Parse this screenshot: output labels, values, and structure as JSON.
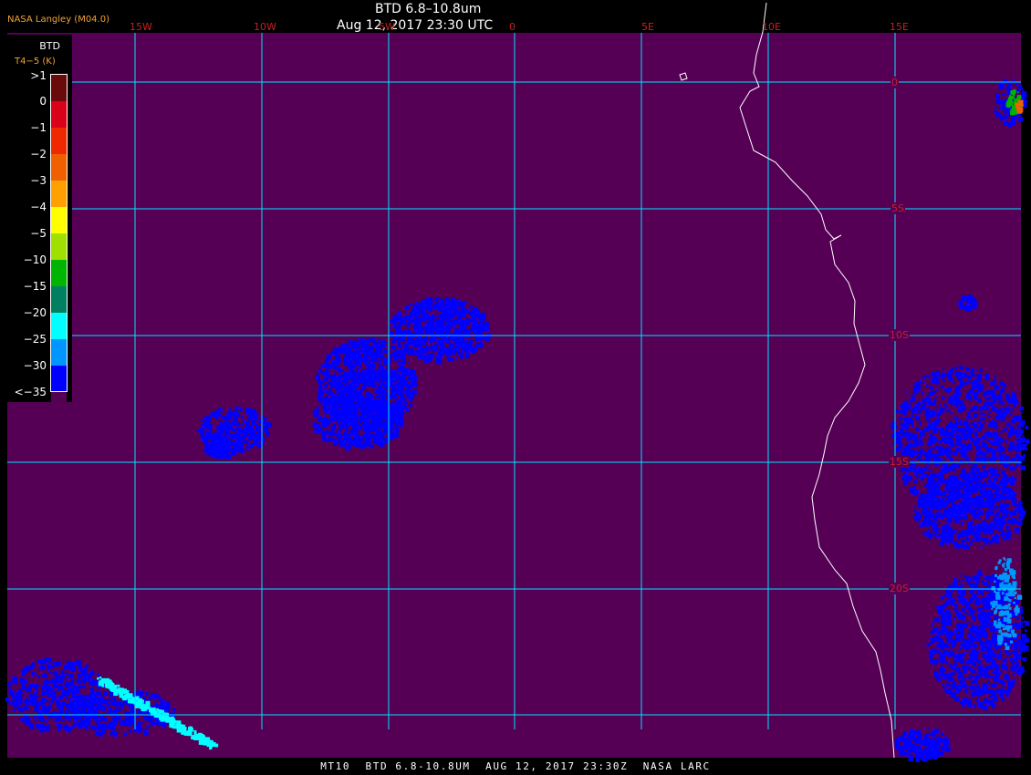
{
  "header": {
    "title": "BTD 6.8–10.8um",
    "subtitle": "Aug 12, 2017 23:30 UTC",
    "provider": "NASA Langley (M04.0)"
  },
  "footer": {
    "caption": "MT10  BTD 6.8-10.8UM  AUG 12, 2017 23:30Z  NASA LARC"
  },
  "legend": {
    "title": "BTD",
    "subtitle": "T4−5 (K)",
    "labels": [
      ">1",
      "0",
      "−1",
      "−2",
      "−3",
      "−4",
      "−5",
      "−10",
      "−15",
      "−20",
      "−25",
      "−30",
      "<−35"
    ],
    "colors": [
      "#6b0a0a",
      "#d9001a",
      "#f02800",
      "#f06000",
      "#ffa000",
      "#ffff00",
      "#a0e000",
      "#00b400",
      "#008060",
      "#00ffff",
      "#0096ff",
      "#0000ff",
      "#550055"
    ]
  },
  "grid": {
    "lon_labels": [
      "15W",
      "10W",
      "5W",
      "0",
      "5E",
      "10E",
      "15E"
    ],
    "lat_labels": [
      "0",
      "5S",
      "10S",
      "15S",
      "20S"
    ]
  },
  "colors": {
    "background": "#550055",
    "gridline": "#00e5ff",
    "coastline": "#ffffff",
    "cloud": "#0000ff"
  }
}
